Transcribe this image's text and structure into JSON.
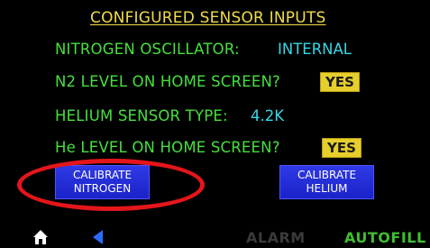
{
  "header": {
    "title": "CONFIGURED SENSOR INPUTS"
  },
  "settings": {
    "nitrogen_oscillator": {
      "label": "NITROGEN OSCILLATOR:",
      "value": "INTERNAL"
    },
    "n2_level_home": {
      "label": "N2 LEVEL ON HOME SCREEN?",
      "value": "YES"
    },
    "helium_sensor_type": {
      "label": "HELIUM SENSOR TYPE:",
      "value": "4.2K"
    },
    "he_level_home": {
      "label": "He LEVEL ON HOME SCREEN?",
      "value": "YES"
    }
  },
  "buttons": {
    "calibrate_nitrogen": {
      "line1": "CALIBRATE",
      "line2": "NITROGEN"
    },
    "calibrate_helium": {
      "line1": "CALIBRATE",
      "line2": "HELIUM"
    }
  },
  "footer": {
    "alarm_label": "ALARM",
    "autofill_label": "AUTOFILL",
    "home_icon": "home-icon",
    "back_icon": "back-arrow-icon"
  },
  "colors": {
    "background": "#000000",
    "title": "#f0dc4b",
    "label": "#46e03c",
    "value": "#36d7e6",
    "yes_button": "#e6cf2d",
    "calibrate_button": "#1f28d8",
    "highlight_ellipse": "#e4161b",
    "alarm_inactive": "#3a3a3a",
    "autofill_active": "#3fbf2e"
  }
}
